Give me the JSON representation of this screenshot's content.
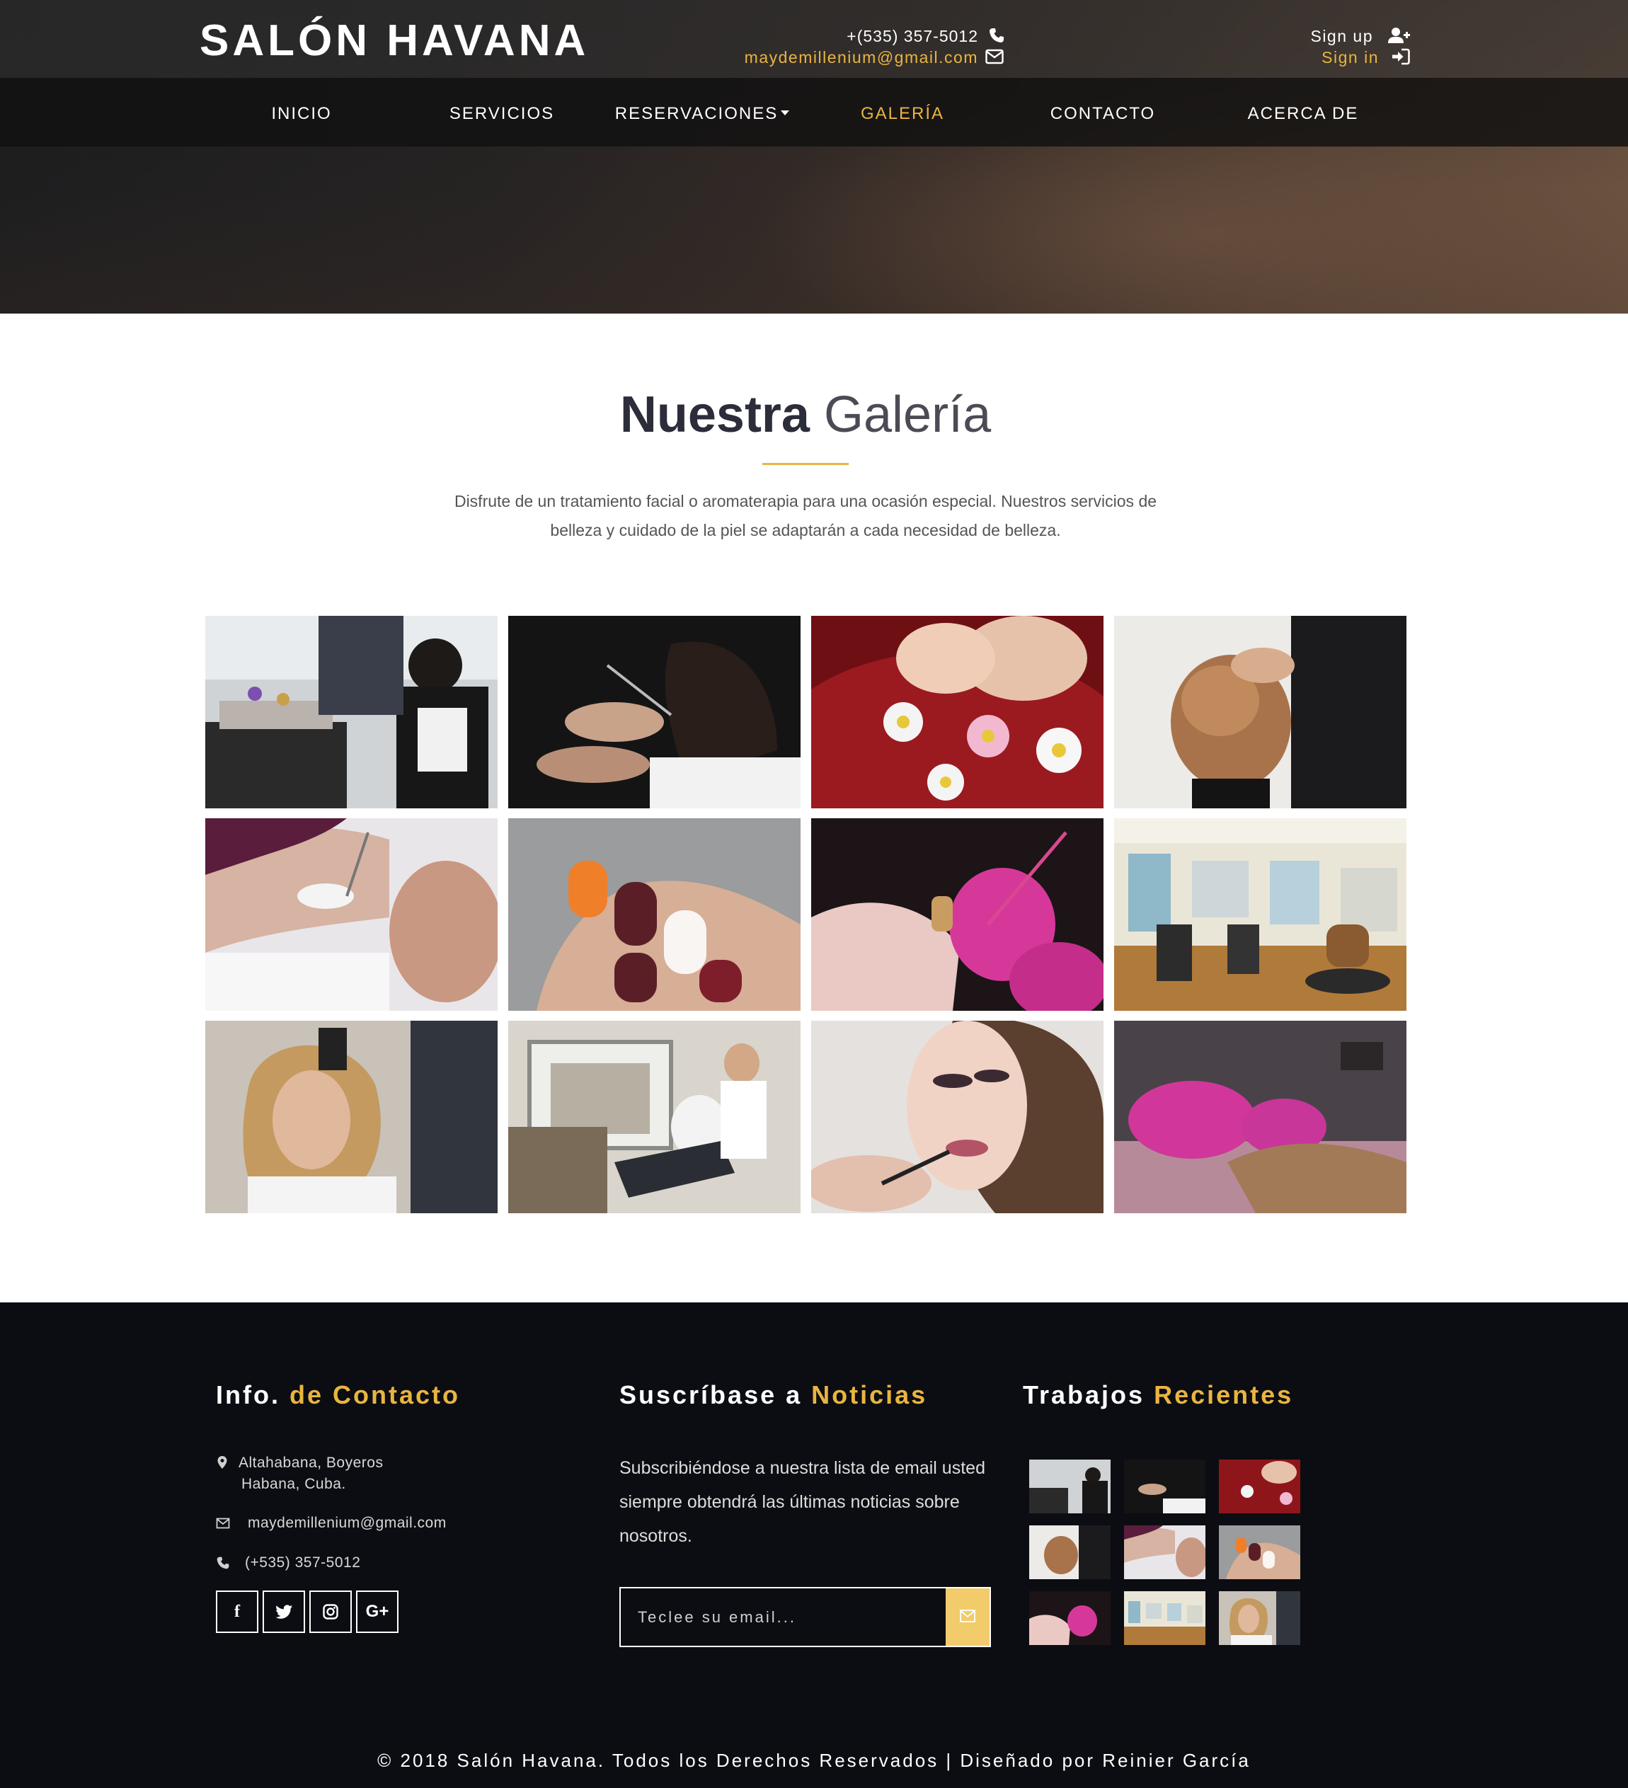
{
  "brand": {
    "logo": "SALÓN HAVANA"
  },
  "topbar": {
    "phone": "+(535) 357-5012",
    "email": "maydemillenium@gmail.com",
    "signup": "Sign up",
    "signin": "Sign in"
  },
  "nav": {
    "items": [
      {
        "label": "INICIO"
      },
      {
        "label": "SERVICIOS"
      },
      {
        "label": "RESERVACIONES"
      },
      {
        "label": "GALERÍA",
        "active": true
      },
      {
        "label": "CONTACTO"
      },
      {
        "label": "ACERCA DE"
      }
    ]
  },
  "gallery": {
    "title_strong": "Nuestra",
    "title_light": "Galería",
    "description": "Disfrute de un tratamiento facial o aromaterapia para una ocasión especial. Nuestros servicios de belleza y cuidado de la piel se adaptarán a cada necesidad de belleza.",
    "images": [
      "salon-styling-station",
      "haircut-scissors",
      "pedicure-flowers",
      "updo-hairstyle",
      "eyelash-extension",
      "nail-art",
      "manicure-pink-gloves",
      "salon-interior",
      "blonde-blowdry",
      "salon-fun-chair",
      "lipstick-makeup",
      "nail-filing"
    ]
  },
  "footer": {
    "contact": {
      "heading_white": "Info.",
      "heading_gold": "de Contacto",
      "address_line1": "Altahabana, Boyeros",
      "address_line2": "Habana, Cuba.",
      "email": "maydemillenium@gmail.com",
      "phone": "(+535) 357-5012",
      "social": [
        "facebook",
        "twitter",
        "instagram",
        "google-plus"
      ]
    },
    "newsletter": {
      "heading_white": "Suscríbase a",
      "heading_gold": "Noticias",
      "text": "Subscribiéndose a nuestra lista de email usted siempre obtendrá las últimas noticias sobre nosotros.",
      "placeholder": "Teclee su email..."
    },
    "recent": {
      "heading_white": "Trabajos",
      "heading_gold": "Recientes"
    },
    "copyright": "© 2018 Salón Havana. Todos los Derechos Reservados | Diseñado por Reinier García"
  },
  "colors": {
    "accent": "#e8b540",
    "footer_bg": "#0c0d12",
    "title": "#2c2d3a"
  }
}
